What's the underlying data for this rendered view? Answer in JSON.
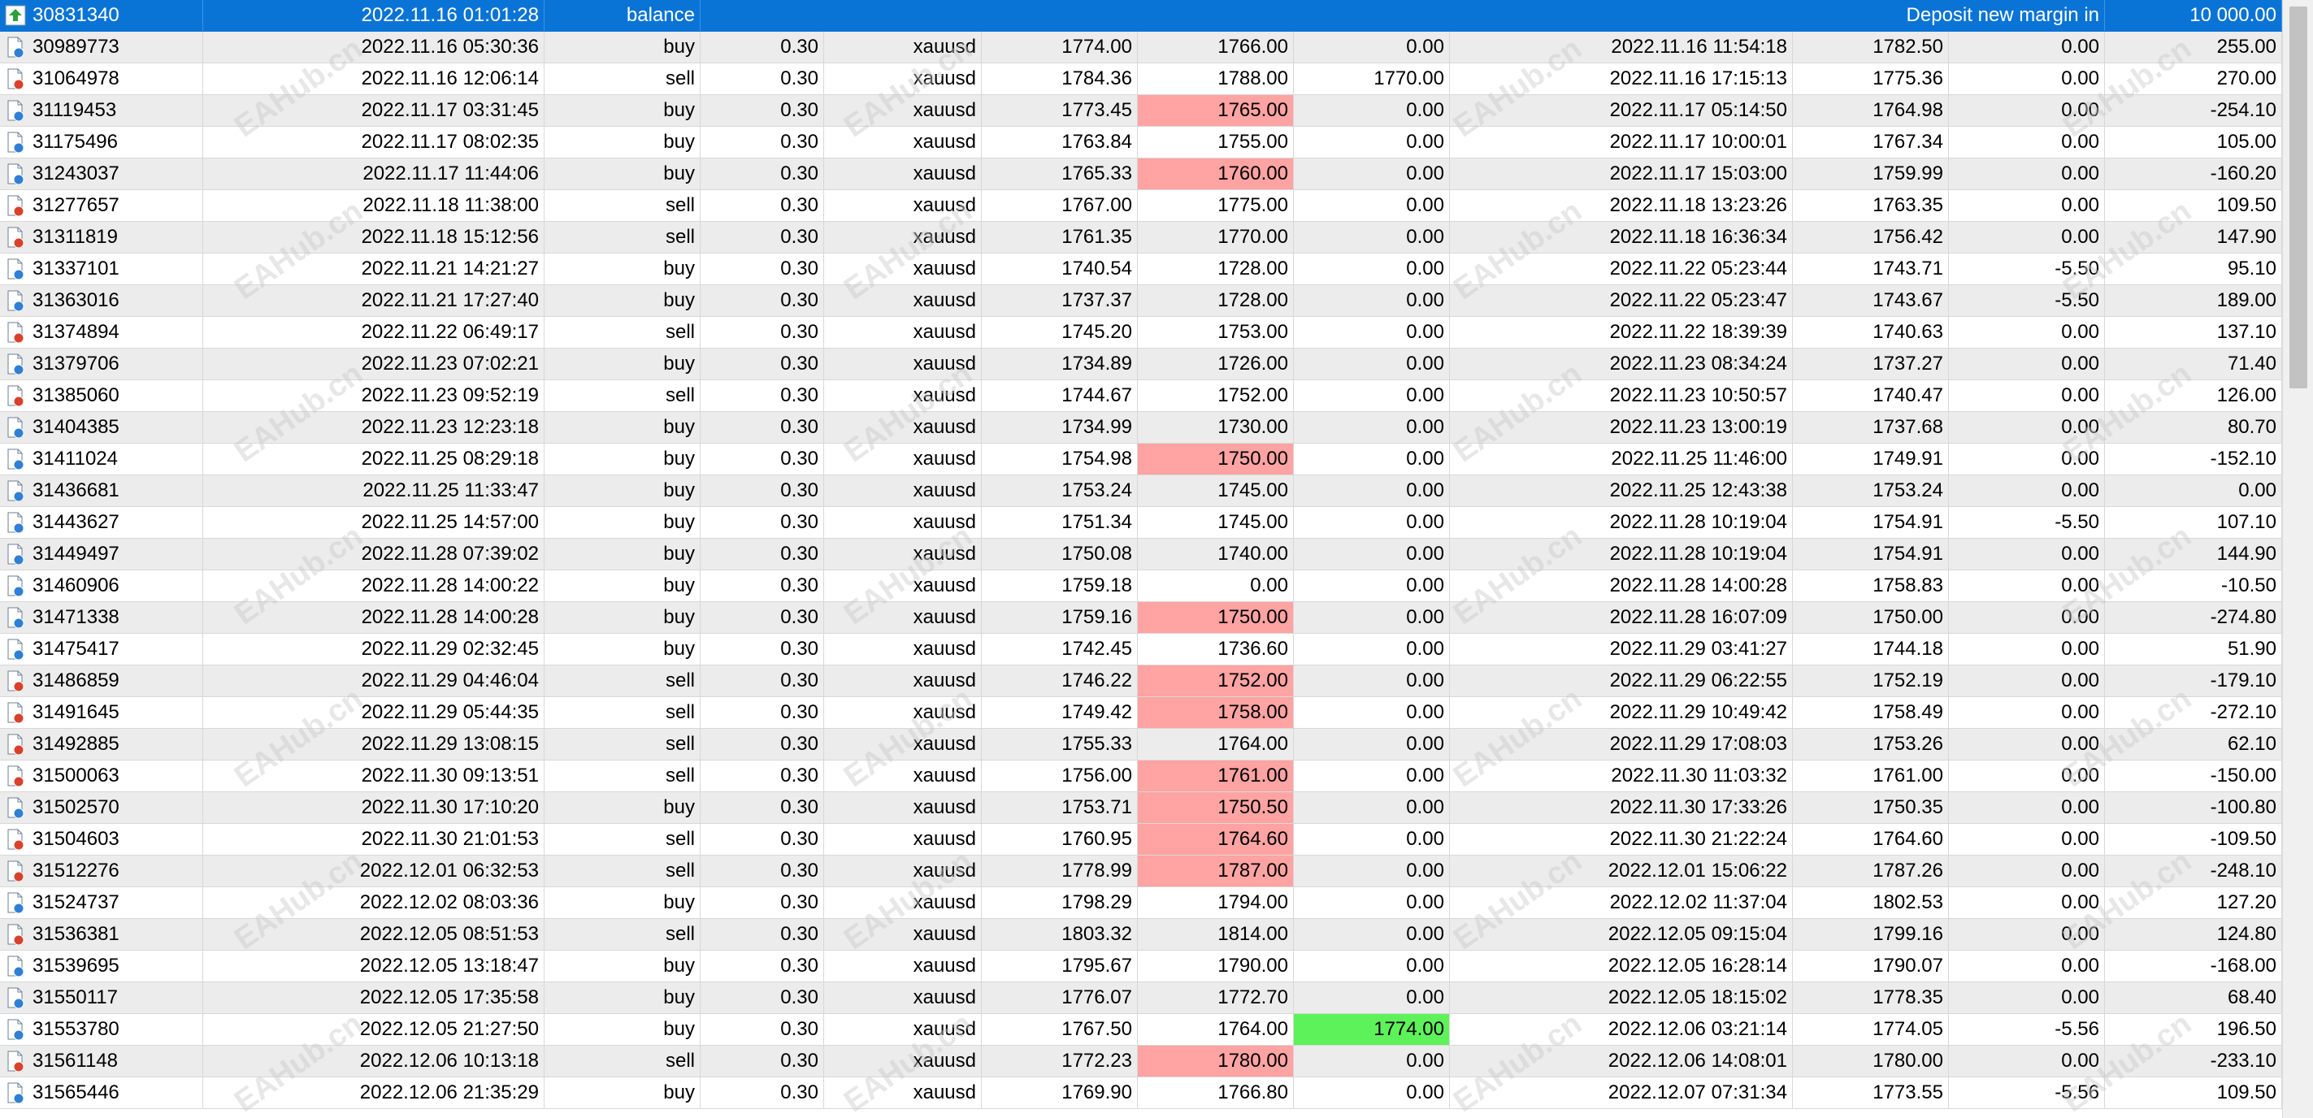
{
  "watermark": {
    "text": "EAHub.cn"
  },
  "colors": {
    "selected": "#0a74d6",
    "loss_highlight": "#ffa3a3",
    "profit_highlight": "#5df25a",
    "alt_row": "#ececec"
  },
  "header_row": {
    "ticket": "30831340",
    "time": "2022.11.16 01:01:28",
    "type": "balance",
    "comment": "Deposit new margin in",
    "profit": "10 000.00",
    "icon": "balance-deposit-icon"
  },
  "rows": [
    {
      "ticket": "30989773",
      "open_time": "2022.11.16 05:30:36",
      "type": "buy",
      "volume": "0.30",
      "symbol": "xauusd",
      "open_price": "1774.00",
      "sl": "1766.00",
      "tp": "0.00",
      "close_time": "2022.11.16 11:54:18",
      "close_price": "1782.50",
      "swap": "0.00",
      "profit": "255.00",
      "sl_hit": false,
      "tp_hit": false
    },
    {
      "ticket": "31064978",
      "open_time": "2022.11.16 12:06:14",
      "type": "sell",
      "volume": "0.30",
      "symbol": "xauusd",
      "open_price": "1784.36",
      "sl": "1788.00",
      "tp": "1770.00",
      "close_time": "2022.11.16 17:15:13",
      "close_price": "1775.36",
      "swap": "0.00",
      "profit": "270.00",
      "sl_hit": false,
      "tp_hit": false
    },
    {
      "ticket": "31119453",
      "open_time": "2022.11.17 03:31:45",
      "type": "buy",
      "volume": "0.30",
      "symbol": "xauusd",
      "open_price": "1773.45",
      "sl": "1765.00",
      "tp": "0.00",
      "close_time": "2022.11.17 05:14:50",
      "close_price": "1764.98",
      "swap": "0.00",
      "profit": "-254.10",
      "sl_hit": true,
      "tp_hit": false
    },
    {
      "ticket": "31175496",
      "open_time": "2022.11.17 08:02:35",
      "type": "buy",
      "volume": "0.30",
      "symbol": "xauusd",
      "open_price": "1763.84",
      "sl": "1755.00",
      "tp": "0.00",
      "close_time": "2022.11.17 10:00:01",
      "close_price": "1767.34",
      "swap": "0.00",
      "profit": "105.00",
      "sl_hit": false,
      "tp_hit": false
    },
    {
      "ticket": "31243037",
      "open_time": "2022.11.17 11:44:06",
      "type": "buy",
      "volume": "0.30",
      "symbol": "xauusd",
      "open_price": "1765.33",
      "sl": "1760.00",
      "tp": "0.00",
      "close_time": "2022.11.17 15:03:00",
      "close_price": "1759.99",
      "swap": "0.00",
      "profit": "-160.20",
      "sl_hit": true,
      "tp_hit": false
    },
    {
      "ticket": "31277657",
      "open_time": "2022.11.18 11:38:00",
      "type": "sell",
      "volume": "0.30",
      "symbol": "xauusd",
      "open_price": "1767.00",
      "sl": "1775.00",
      "tp": "0.00",
      "close_time": "2022.11.18 13:23:26",
      "close_price": "1763.35",
      "swap": "0.00",
      "profit": "109.50",
      "sl_hit": false,
      "tp_hit": false
    },
    {
      "ticket": "31311819",
      "open_time": "2022.11.18 15:12:56",
      "type": "sell",
      "volume": "0.30",
      "symbol": "xauusd",
      "open_price": "1761.35",
      "sl": "1770.00",
      "tp": "0.00",
      "close_time": "2022.11.18 16:36:34",
      "close_price": "1756.42",
      "swap": "0.00",
      "profit": "147.90",
      "sl_hit": false,
      "tp_hit": false
    },
    {
      "ticket": "31337101",
      "open_time": "2022.11.21 14:21:27",
      "type": "buy",
      "volume": "0.30",
      "symbol": "xauusd",
      "open_price": "1740.54",
      "sl": "1728.00",
      "tp": "0.00",
      "close_time": "2022.11.22 05:23:44",
      "close_price": "1743.71",
      "swap": "-5.50",
      "profit": "95.10",
      "sl_hit": false,
      "tp_hit": false
    },
    {
      "ticket": "31363016",
      "open_time": "2022.11.21 17:27:40",
      "type": "buy",
      "volume": "0.30",
      "symbol": "xauusd",
      "open_price": "1737.37",
      "sl": "1728.00",
      "tp": "0.00",
      "close_time": "2022.11.22 05:23:47",
      "close_price": "1743.67",
      "swap": "-5.50",
      "profit": "189.00",
      "sl_hit": false,
      "tp_hit": false
    },
    {
      "ticket": "31374894",
      "open_time": "2022.11.22 06:49:17",
      "type": "sell",
      "volume": "0.30",
      "symbol": "xauusd",
      "open_price": "1745.20",
      "sl": "1753.00",
      "tp": "0.00",
      "close_time": "2022.11.22 18:39:39",
      "close_price": "1740.63",
      "swap": "0.00",
      "profit": "137.10",
      "sl_hit": false,
      "tp_hit": false
    },
    {
      "ticket": "31379706",
      "open_time": "2022.11.23 07:02:21",
      "type": "buy",
      "volume": "0.30",
      "symbol": "xauusd",
      "open_price": "1734.89",
      "sl": "1726.00",
      "tp": "0.00",
      "close_time": "2022.11.23 08:34:24",
      "close_price": "1737.27",
      "swap": "0.00",
      "profit": "71.40",
      "sl_hit": false,
      "tp_hit": false
    },
    {
      "ticket": "31385060",
      "open_time": "2022.11.23 09:52:19",
      "type": "sell",
      "volume": "0.30",
      "symbol": "xauusd",
      "open_price": "1744.67",
      "sl": "1752.00",
      "tp": "0.00",
      "close_time": "2022.11.23 10:50:57",
      "close_price": "1740.47",
      "swap": "0.00",
      "profit": "126.00",
      "sl_hit": false,
      "tp_hit": false
    },
    {
      "ticket": "31404385",
      "open_time": "2022.11.23 12:23:18",
      "type": "buy",
      "volume": "0.30",
      "symbol": "xauusd",
      "open_price": "1734.99",
      "sl": "1730.00",
      "tp": "0.00",
      "close_time": "2022.11.23 13:00:19",
      "close_price": "1737.68",
      "swap": "0.00",
      "profit": "80.70",
      "sl_hit": false,
      "tp_hit": false
    },
    {
      "ticket": "31411024",
      "open_time": "2022.11.25 08:29:18",
      "type": "buy",
      "volume": "0.30",
      "symbol": "xauusd",
      "open_price": "1754.98",
      "sl": "1750.00",
      "tp": "0.00",
      "close_time": "2022.11.25 11:46:00",
      "close_price": "1749.91",
      "swap": "0.00",
      "profit": "-152.10",
      "sl_hit": true,
      "tp_hit": false
    },
    {
      "ticket": "31436681",
      "open_time": "2022.11.25 11:33:47",
      "type": "buy",
      "volume": "0.30",
      "symbol": "xauusd",
      "open_price": "1753.24",
      "sl": "1745.00",
      "tp": "0.00",
      "close_time": "2022.11.25 12:43:38",
      "close_price": "1753.24",
      "swap": "0.00",
      "profit": "0.00",
      "sl_hit": false,
      "tp_hit": false
    },
    {
      "ticket": "31443627",
      "open_time": "2022.11.25 14:57:00",
      "type": "buy",
      "volume": "0.30",
      "symbol": "xauusd",
      "open_price": "1751.34",
      "sl": "1745.00",
      "tp": "0.00",
      "close_time": "2022.11.28 10:19:04",
      "close_price": "1754.91",
      "swap": "-5.50",
      "profit": "107.10",
      "sl_hit": false,
      "tp_hit": false
    },
    {
      "ticket": "31449497",
      "open_time": "2022.11.28 07:39:02",
      "type": "buy",
      "volume": "0.30",
      "symbol": "xauusd",
      "open_price": "1750.08",
      "sl": "1740.00",
      "tp": "0.00",
      "close_time": "2022.11.28 10:19:04",
      "close_price": "1754.91",
      "swap": "0.00",
      "profit": "144.90",
      "sl_hit": false,
      "tp_hit": false
    },
    {
      "ticket": "31460906",
      "open_time": "2022.11.28 14:00:22",
      "type": "buy",
      "volume": "0.30",
      "symbol": "xauusd",
      "open_price": "1759.18",
      "sl": "0.00",
      "tp": "0.00",
      "close_time": "2022.11.28 14:00:28",
      "close_price": "1758.83",
      "swap": "0.00",
      "profit": "-10.50",
      "sl_hit": false,
      "tp_hit": false
    },
    {
      "ticket": "31471338",
      "open_time": "2022.11.28 14:00:28",
      "type": "buy",
      "volume": "0.30",
      "symbol": "xauusd",
      "open_price": "1759.16",
      "sl": "1750.00",
      "tp": "0.00",
      "close_time": "2022.11.28 16:07:09",
      "close_price": "1750.00",
      "swap": "0.00",
      "profit": "-274.80",
      "sl_hit": true,
      "tp_hit": false
    },
    {
      "ticket": "31475417",
      "open_time": "2022.11.29 02:32:45",
      "type": "buy",
      "volume": "0.30",
      "symbol": "xauusd",
      "open_price": "1742.45",
      "sl": "1736.60",
      "tp": "0.00",
      "close_time": "2022.11.29 03:41:27",
      "close_price": "1744.18",
      "swap": "0.00",
      "profit": "51.90",
      "sl_hit": false,
      "tp_hit": false
    },
    {
      "ticket": "31486859",
      "open_time": "2022.11.29 04:46:04",
      "type": "sell",
      "volume": "0.30",
      "symbol": "xauusd",
      "open_price": "1746.22",
      "sl": "1752.00",
      "tp": "0.00",
      "close_time": "2022.11.29 06:22:55",
      "close_price": "1752.19",
      "swap": "0.00",
      "profit": "-179.10",
      "sl_hit": true,
      "tp_hit": false
    },
    {
      "ticket": "31491645",
      "open_time": "2022.11.29 05:44:35",
      "type": "sell",
      "volume": "0.30",
      "symbol": "xauusd",
      "open_price": "1749.42",
      "sl": "1758.00",
      "tp": "0.00",
      "close_time": "2022.11.29 10:49:42",
      "close_price": "1758.49",
      "swap": "0.00",
      "profit": "-272.10",
      "sl_hit": true,
      "tp_hit": false
    },
    {
      "ticket": "31492885",
      "open_time": "2022.11.29 13:08:15",
      "type": "sell",
      "volume": "0.30",
      "symbol": "xauusd",
      "open_price": "1755.33",
      "sl": "1764.00",
      "tp": "0.00",
      "close_time": "2022.11.29 17:08:03",
      "close_price": "1753.26",
      "swap": "0.00",
      "profit": "62.10",
      "sl_hit": false,
      "tp_hit": false
    },
    {
      "ticket": "31500063",
      "open_time": "2022.11.30 09:13:51",
      "type": "sell",
      "volume": "0.30",
      "symbol": "xauusd",
      "open_price": "1756.00",
      "sl": "1761.00",
      "tp": "0.00",
      "close_time": "2022.11.30 11:03:32",
      "close_price": "1761.00",
      "swap": "0.00",
      "profit": "-150.00",
      "sl_hit": true,
      "tp_hit": false
    },
    {
      "ticket": "31502570",
      "open_time": "2022.11.30 17:10:20",
      "type": "buy",
      "volume": "0.30",
      "symbol": "xauusd",
      "open_price": "1753.71",
      "sl": "1750.50",
      "tp": "0.00",
      "close_time": "2022.11.30 17:33:26",
      "close_price": "1750.35",
      "swap": "0.00",
      "profit": "-100.80",
      "sl_hit": true,
      "tp_hit": false
    },
    {
      "ticket": "31504603",
      "open_time": "2022.11.30 21:01:53",
      "type": "sell",
      "volume": "0.30",
      "symbol": "xauusd",
      "open_price": "1760.95",
      "sl": "1764.60",
      "tp": "0.00",
      "close_time": "2022.11.30 21:22:24",
      "close_price": "1764.60",
      "swap": "0.00",
      "profit": "-109.50",
      "sl_hit": true,
      "tp_hit": false
    },
    {
      "ticket": "31512276",
      "open_time": "2022.12.01 06:32:53",
      "type": "sell",
      "volume": "0.30",
      "symbol": "xauusd",
      "open_price": "1778.99",
      "sl": "1787.00",
      "tp": "0.00",
      "close_time": "2022.12.01 15:06:22",
      "close_price": "1787.26",
      "swap": "0.00",
      "profit": "-248.10",
      "sl_hit": true,
      "tp_hit": false
    },
    {
      "ticket": "31524737",
      "open_time": "2022.12.02 08:03:36",
      "type": "buy",
      "volume": "0.30",
      "symbol": "xauusd",
      "open_price": "1798.29",
      "sl": "1794.00",
      "tp": "0.00",
      "close_time": "2022.12.02 11:37:04",
      "close_price": "1802.53",
      "swap": "0.00",
      "profit": "127.20",
      "sl_hit": false,
      "tp_hit": false
    },
    {
      "ticket": "31536381",
      "open_time": "2022.12.05 08:51:53",
      "type": "sell",
      "volume": "0.30",
      "symbol": "xauusd",
      "open_price": "1803.32",
      "sl": "1814.00",
      "tp": "0.00",
      "close_time": "2022.12.05 09:15:04",
      "close_price": "1799.16",
      "swap": "0.00",
      "profit": "124.80",
      "sl_hit": false,
      "tp_hit": false
    },
    {
      "ticket": "31539695",
      "open_time": "2022.12.05 13:18:47",
      "type": "buy",
      "volume": "0.30",
      "symbol": "xauusd",
      "open_price": "1795.67",
      "sl": "1790.00",
      "tp": "0.00",
      "close_time": "2022.12.05 16:28:14",
      "close_price": "1790.07",
      "swap": "0.00",
      "profit": "-168.00",
      "sl_hit": false,
      "tp_hit": false
    },
    {
      "ticket": "31550117",
      "open_time": "2022.12.05 17:35:58",
      "type": "buy",
      "volume": "0.30",
      "symbol": "xauusd",
      "open_price": "1776.07",
      "sl": "1772.70",
      "tp": "0.00",
      "close_time": "2022.12.05 18:15:02",
      "close_price": "1778.35",
      "swap": "0.00",
      "profit": "68.40",
      "sl_hit": false,
      "tp_hit": false
    },
    {
      "ticket": "31553780",
      "open_time": "2022.12.05 21:27:50",
      "type": "buy",
      "volume": "0.30",
      "symbol": "xauusd",
      "open_price": "1767.50",
      "sl": "1764.00",
      "tp": "1774.00",
      "close_time": "2022.12.06 03:21:14",
      "close_price": "1774.05",
      "swap": "-5.56",
      "profit": "196.50",
      "sl_hit": false,
      "tp_hit": true
    },
    {
      "ticket": "31561148",
      "open_time": "2022.12.06 10:13:18",
      "type": "sell",
      "volume": "0.30",
      "symbol": "xauusd",
      "open_price": "1772.23",
      "sl": "1780.00",
      "tp": "0.00",
      "close_time": "2022.12.06 14:08:01",
      "close_price": "1780.00",
      "swap": "0.00",
      "profit": "-233.10",
      "sl_hit": true,
      "tp_hit": false
    },
    {
      "ticket": "31565446",
      "open_time": "2022.12.06 21:35:29",
      "type": "buy",
      "volume": "0.30",
      "symbol": "xauusd",
      "open_price": "1769.90",
      "sl": "1766.80",
      "tp": "0.00",
      "close_time": "2022.12.07 07:31:34",
      "close_price": "1773.55",
      "swap": "-5.56",
      "profit": "109.50",
      "sl_hit": false,
      "tp_hit": false
    }
  ]
}
